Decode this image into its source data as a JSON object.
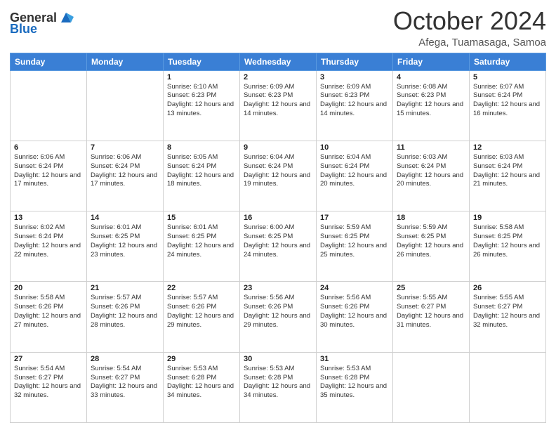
{
  "logo": {
    "general": "General",
    "blue": "Blue"
  },
  "header": {
    "month": "October 2024",
    "location": "Afega, Tuamasaga, Samoa"
  },
  "weekdays": [
    "Sunday",
    "Monday",
    "Tuesday",
    "Wednesday",
    "Thursday",
    "Friday",
    "Saturday"
  ],
  "weeks": [
    [
      {
        "day": "",
        "sunrise": "",
        "sunset": "",
        "daylight": ""
      },
      {
        "day": "",
        "sunrise": "",
        "sunset": "",
        "daylight": ""
      },
      {
        "day": "1",
        "sunrise": "Sunrise: 6:10 AM",
        "sunset": "Sunset: 6:23 PM",
        "daylight": "Daylight: 12 hours and 13 minutes."
      },
      {
        "day": "2",
        "sunrise": "Sunrise: 6:09 AM",
        "sunset": "Sunset: 6:23 PM",
        "daylight": "Daylight: 12 hours and 14 minutes."
      },
      {
        "day": "3",
        "sunrise": "Sunrise: 6:09 AM",
        "sunset": "Sunset: 6:23 PM",
        "daylight": "Daylight: 12 hours and 14 minutes."
      },
      {
        "day": "4",
        "sunrise": "Sunrise: 6:08 AM",
        "sunset": "Sunset: 6:23 PM",
        "daylight": "Daylight: 12 hours and 15 minutes."
      },
      {
        "day": "5",
        "sunrise": "Sunrise: 6:07 AM",
        "sunset": "Sunset: 6:24 PM",
        "daylight": "Daylight: 12 hours and 16 minutes."
      }
    ],
    [
      {
        "day": "6",
        "sunrise": "Sunrise: 6:06 AM",
        "sunset": "Sunset: 6:24 PM",
        "daylight": "Daylight: 12 hours and 17 minutes."
      },
      {
        "day": "7",
        "sunrise": "Sunrise: 6:06 AM",
        "sunset": "Sunset: 6:24 PM",
        "daylight": "Daylight: 12 hours and 17 minutes."
      },
      {
        "day": "8",
        "sunrise": "Sunrise: 6:05 AM",
        "sunset": "Sunset: 6:24 PM",
        "daylight": "Daylight: 12 hours and 18 minutes."
      },
      {
        "day": "9",
        "sunrise": "Sunrise: 6:04 AM",
        "sunset": "Sunset: 6:24 PM",
        "daylight": "Daylight: 12 hours and 19 minutes."
      },
      {
        "day": "10",
        "sunrise": "Sunrise: 6:04 AM",
        "sunset": "Sunset: 6:24 PM",
        "daylight": "Daylight: 12 hours and 20 minutes."
      },
      {
        "day": "11",
        "sunrise": "Sunrise: 6:03 AM",
        "sunset": "Sunset: 6:24 PM",
        "daylight": "Daylight: 12 hours and 20 minutes."
      },
      {
        "day": "12",
        "sunrise": "Sunrise: 6:03 AM",
        "sunset": "Sunset: 6:24 PM",
        "daylight": "Daylight: 12 hours and 21 minutes."
      }
    ],
    [
      {
        "day": "13",
        "sunrise": "Sunrise: 6:02 AM",
        "sunset": "Sunset: 6:24 PM",
        "daylight": "Daylight: 12 hours and 22 minutes."
      },
      {
        "day": "14",
        "sunrise": "Sunrise: 6:01 AM",
        "sunset": "Sunset: 6:25 PM",
        "daylight": "Daylight: 12 hours and 23 minutes."
      },
      {
        "day": "15",
        "sunrise": "Sunrise: 6:01 AM",
        "sunset": "Sunset: 6:25 PM",
        "daylight": "Daylight: 12 hours and 24 minutes."
      },
      {
        "day": "16",
        "sunrise": "Sunrise: 6:00 AM",
        "sunset": "Sunset: 6:25 PM",
        "daylight": "Daylight: 12 hours and 24 minutes."
      },
      {
        "day": "17",
        "sunrise": "Sunrise: 5:59 AM",
        "sunset": "Sunset: 6:25 PM",
        "daylight": "Daylight: 12 hours and 25 minutes."
      },
      {
        "day": "18",
        "sunrise": "Sunrise: 5:59 AM",
        "sunset": "Sunset: 6:25 PM",
        "daylight": "Daylight: 12 hours and 26 minutes."
      },
      {
        "day": "19",
        "sunrise": "Sunrise: 5:58 AM",
        "sunset": "Sunset: 6:25 PM",
        "daylight": "Daylight: 12 hours and 26 minutes."
      }
    ],
    [
      {
        "day": "20",
        "sunrise": "Sunrise: 5:58 AM",
        "sunset": "Sunset: 6:26 PM",
        "daylight": "Daylight: 12 hours and 27 minutes."
      },
      {
        "day": "21",
        "sunrise": "Sunrise: 5:57 AM",
        "sunset": "Sunset: 6:26 PM",
        "daylight": "Daylight: 12 hours and 28 minutes."
      },
      {
        "day": "22",
        "sunrise": "Sunrise: 5:57 AM",
        "sunset": "Sunset: 6:26 PM",
        "daylight": "Daylight: 12 hours and 29 minutes."
      },
      {
        "day": "23",
        "sunrise": "Sunrise: 5:56 AM",
        "sunset": "Sunset: 6:26 PM",
        "daylight": "Daylight: 12 hours and 29 minutes."
      },
      {
        "day": "24",
        "sunrise": "Sunrise: 5:56 AM",
        "sunset": "Sunset: 6:26 PM",
        "daylight": "Daylight: 12 hours and 30 minutes."
      },
      {
        "day": "25",
        "sunrise": "Sunrise: 5:55 AM",
        "sunset": "Sunset: 6:27 PM",
        "daylight": "Daylight: 12 hours and 31 minutes."
      },
      {
        "day": "26",
        "sunrise": "Sunrise: 5:55 AM",
        "sunset": "Sunset: 6:27 PM",
        "daylight": "Daylight: 12 hours and 32 minutes."
      }
    ],
    [
      {
        "day": "27",
        "sunrise": "Sunrise: 5:54 AM",
        "sunset": "Sunset: 6:27 PM",
        "daylight": "Daylight: 12 hours and 32 minutes."
      },
      {
        "day": "28",
        "sunrise": "Sunrise: 5:54 AM",
        "sunset": "Sunset: 6:27 PM",
        "daylight": "Daylight: 12 hours and 33 minutes."
      },
      {
        "day": "29",
        "sunrise": "Sunrise: 5:53 AM",
        "sunset": "Sunset: 6:28 PM",
        "daylight": "Daylight: 12 hours and 34 minutes."
      },
      {
        "day": "30",
        "sunrise": "Sunrise: 5:53 AM",
        "sunset": "Sunset: 6:28 PM",
        "daylight": "Daylight: 12 hours and 34 minutes."
      },
      {
        "day": "31",
        "sunrise": "Sunrise: 5:53 AM",
        "sunset": "Sunset: 6:28 PM",
        "daylight": "Daylight: 12 hours and 35 minutes."
      },
      {
        "day": "",
        "sunrise": "",
        "sunset": "",
        "daylight": ""
      },
      {
        "day": "",
        "sunrise": "",
        "sunset": "",
        "daylight": ""
      }
    ]
  ]
}
